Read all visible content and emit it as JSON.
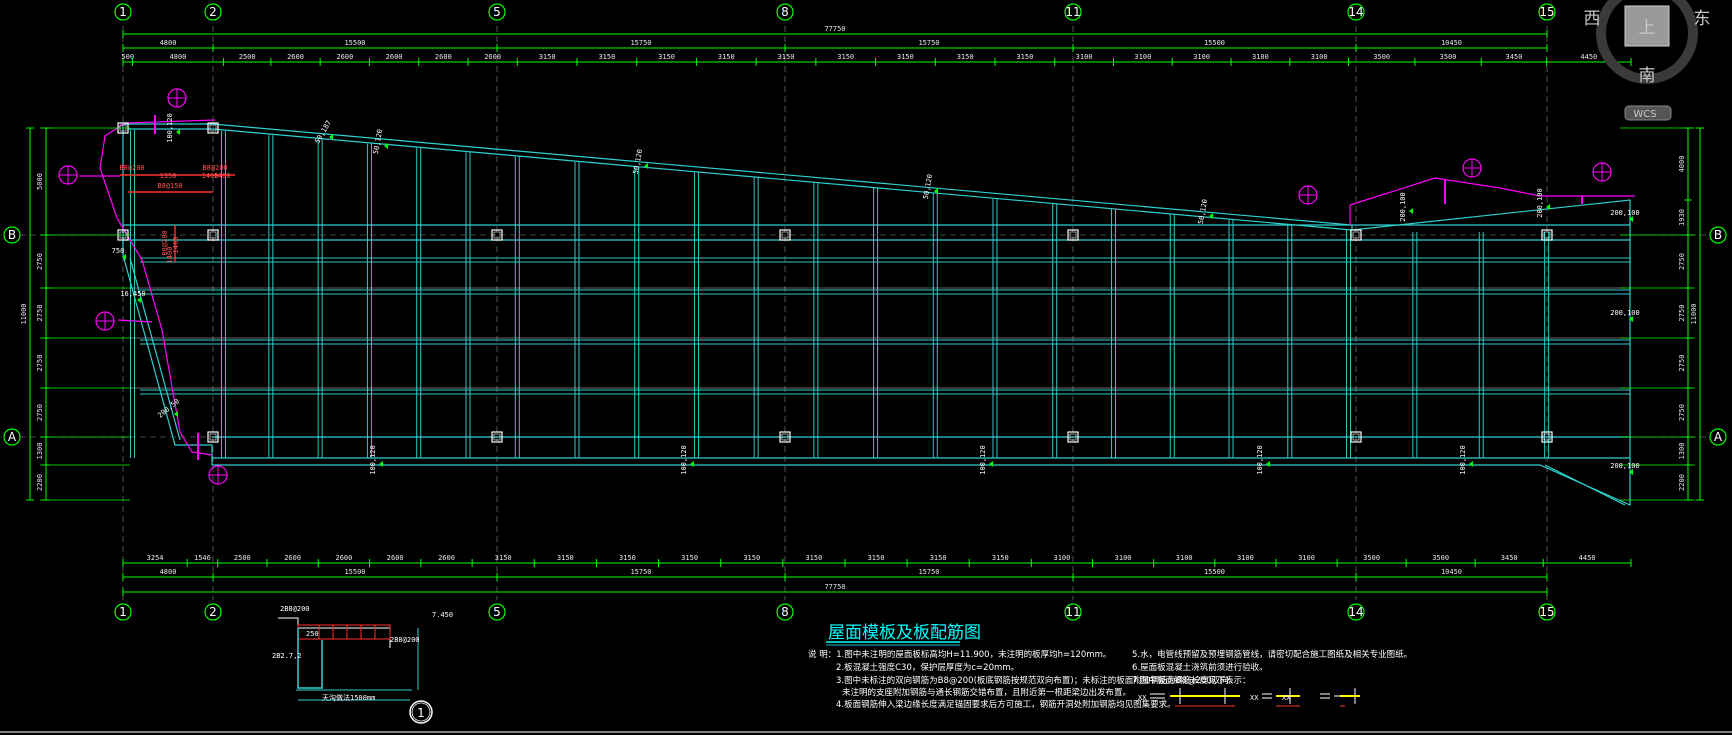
{
  "drawing": {
    "title": "屋面模板及板配筋图",
    "view_cube": {
      "west": "西",
      "east": "东",
      "south": "南",
      "top": "上",
      "wcs": "WCS"
    },
    "axes": {
      "columns": [
        "1",
        "2",
        "5",
        "8",
        "11",
        "14",
        "15"
      ],
      "rows_right": [
        "B",
        "A"
      ],
      "rows_left": [
        "B",
        "A"
      ]
    },
    "top_dims": {
      "overall": "77750",
      "groups": [
        "4800",
        "15500",
        "15750",
        "15750",
        "15500",
        "10450"
      ],
      "spans": [
        "500",
        "4800",
        "2500",
        "2600",
        "2600",
        "2600",
        "2600",
        "2600",
        "3150",
        "3150",
        "3150",
        "3150",
        "3150",
        "3150",
        "3150",
        "3150",
        "3150",
        "3100",
        "3100",
        "3100",
        "3100",
        "3100",
        "3500",
        "3500",
        "3450",
        "4450"
      ]
    },
    "bottom_dims": {
      "overall": "77750",
      "groups": [
        "4800",
        "15500",
        "15750",
        "15750",
        "15500",
        "10450"
      ],
      "spans": [
        "3254",
        "1546",
        "2500",
        "2600",
        "2600",
        "2600",
        "2600",
        "3150",
        "3150",
        "3150",
        "3150",
        "3150",
        "3150",
        "3150",
        "3150",
        "3150",
        "3100",
        "3100",
        "3100",
        "3100",
        "3100",
        "3500",
        "3500",
        "3450",
        "4450"
      ]
    },
    "left_dims": [
      "5000",
      "2750",
      "2750",
      "2750",
      "2750",
      "1300",
      "2200"
    ],
    "left_total": "11000",
    "right_dims": [
      "4000",
      "1930",
      "2750",
      "2750",
      "2750",
      "2750",
      "1300",
      "2200"
    ],
    "right_total": "11000",
    "slab_tags": [
      "100,120",
      "50,187",
      "50,120",
      "50,120",
      "50,120",
      "50,120",
      "200,100",
      "200,100",
      "200,100",
      "200,100",
      "100,120",
      "100,120",
      "100,120",
      "100,120",
      "100,120",
      "200,100",
      "16,450",
      "200,50",
      "750"
    ],
    "rebar_tags": [
      "B8@200",
      "B8@200",
      "1350",
      "1400",
      "1400",
      "B8@150",
      "B8@200",
      "1400",
      "1400"
    ],
    "section": {
      "label": "1",
      "elevation": "7.450",
      "rebar_top": "2B8@200",
      "rebar_right": "2B8@200",
      "left_elev": "2B2.7,2",
      "bottom_note": "天沟做法1500mm",
      "dim_250": "250"
    },
    "notes_left": [
      "说 明：1.图中未注明的屋面板标高均H=11.900，未注明的板厚均h=120mm。",
      "2.板混凝土强度C30，保护层厚度为c=20mm。",
      "3.图中未标注的双向钢筋为B8@200(板底钢筋按规范双向布置)；未标注的板面附加钢筋为B8@200双向。",
      "未注明的支座附加钢筋与通长钢筋交错布置，且附近第一根距梁边出发布置。",
      "4.板面钢筋伸入梁边缘长度满足锚固要求后方可施工，钢筋开洞处附加钢筋均见图集要求。"
    ],
    "notes_right": [
      "5.水，电管线预留及预埋钢筋管线，请密切配合施工图纸及相关专业图纸。",
      "6.屋面板混凝土浇筑前须进行验收。",
      "7.图中板面钢筋长度见下表示："
    ],
    "legend": {
      "item1": "XX",
      "item2": "XX",
      "item3": "XX"
    }
  }
}
